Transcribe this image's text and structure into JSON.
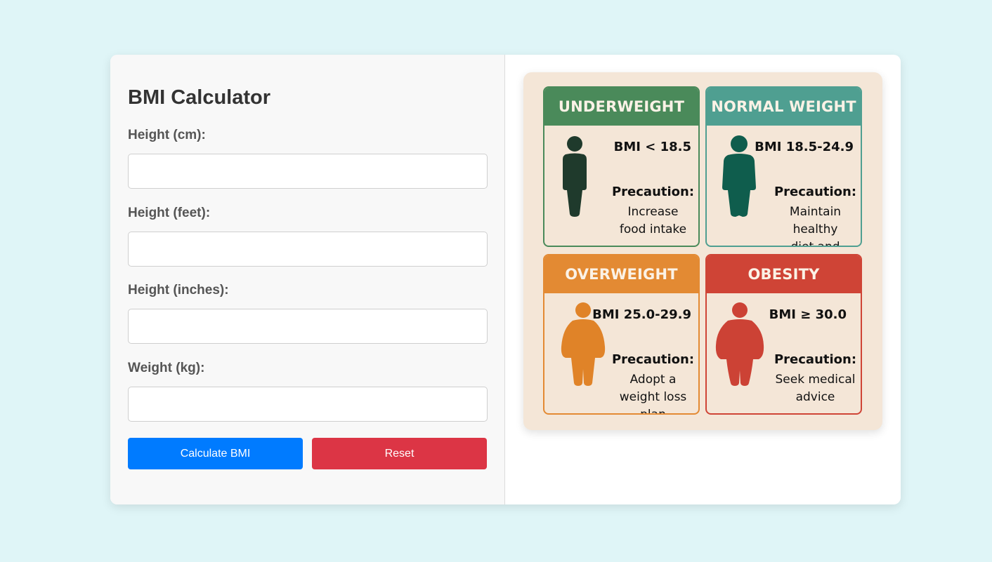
{
  "form": {
    "title": "BMI Calculator",
    "fields": [
      {
        "label": "Height (cm):",
        "value": "",
        "placeholder": ""
      },
      {
        "label": "Height (feet):",
        "value": "",
        "placeholder": ""
      },
      {
        "label": "Height (inches):",
        "value": "",
        "placeholder": ""
      },
      {
        "label": "Weight (kg):",
        "value": "",
        "placeholder": ""
      }
    ],
    "calculate_label": "Calculate BMI",
    "reset_label": "Reset"
  },
  "chart": {
    "categories": [
      {
        "title": "UNDERWEIGHT",
        "range": "BMI < 18.5",
        "precaution_label": "Precaution:",
        "precaution_line1": "Increase",
        "precaution_line2": "food intake",
        "color": "#4a8a5a",
        "figure_color": "#1f3a2c",
        "figure_icon": "thin-person-icon"
      },
      {
        "title": "NORMAL WEIGHT",
        "range": "BMI 18.5-24.9",
        "precaution_label": "Precaution:",
        "precaution_line1": "Maintain healthy",
        "precaution_line2": "diet and exercise",
        "color": "#4f9f91",
        "figure_color": "#0f5d4d",
        "figure_icon": "normal-person-icon"
      },
      {
        "title": "OVERWEIGHT",
        "range": "BMI 25.0-29.9",
        "precaution_label": "Precaution:",
        "precaution_line1": "Adopt a",
        "precaution_line2": "weight loss plan",
        "color": "#e38a33",
        "figure_color": "#e08328",
        "figure_icon": "overweight-person-icon"
      },
      {
        "title": "OBESITY",
        "range": "BMI ≥ 30.0",
        "precaution_label": "Precaution:",
        "precaution_line1": "Seek medical",
        "precaution_line2": "advice",
        "color": "#cf4436",
        "figure_color": "#cc4235",
        "figure_icon": "obese-person-icon"
      }
    ]
  },
  "colors": {
    "page_bg": "#dff5f7",
    "primary_button": "#007bff",
    "danger_button": "#dc3545",
    "chart_bg": "#f4e6d7"
  }
}
